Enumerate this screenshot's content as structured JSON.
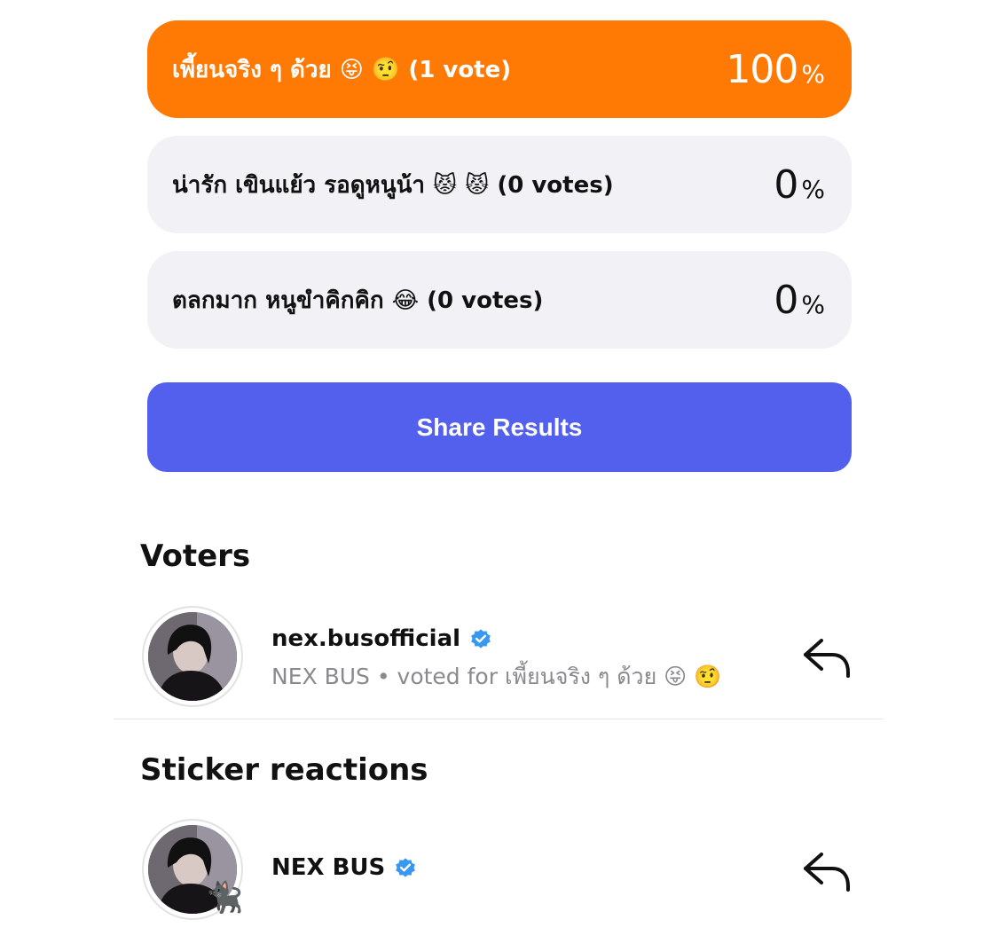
{
  "poll": {
    "options": [
      {
        "label": "เพี้ยนจริง ๆ ด้วย 😝 🤨 (1 vote)",
        "percent_number": "100",
        "percent_sign": "%",
        "selected": true,
        "fraction": 1.0
      },
      {
        "label": "น่ารัก เขินแย้ว รอดูหนูน้า 😾 😾 (0 votes)",
        "percent_number": "0",
        "percent_sign": "%",
        "selected": false,
        "fraction": 0.0
      },
      {
        "label": "ตลกมาก หนูขำคิกคิก 😂 (0 votes)",
        "percent_number": "0",
        "percent_sign": "%",
        "selected": false,
        "fraction": 0.0
      }
    ],
    "share_label": "Share Results"
  },
  "voters": {
    "title": "Voters",
    "items": [
      {
        "username": "nex.busofficial",
        "subtitle": "NEX BUS • voted for เพี้ยนจริง ๆ ด้วย 😝 🤨",
        "verified": true
      }
    ]
  },
  "stickers": {
    "title": "Sticker reactions",
    "items": [
      {
        "username": "NEX BUS",
        "verified": true,
        "sticker": "🐈‍⬛"
      }
    ]
  },
  "colors": {
    "selected_option": "#ff7a05",
    "unselected_option": "#f2f2f6",
    "share_button": "#5360ee",
    "verified_badge": "#3897f0"
  },
  "icons": {
    "verified": "verified-badge-icon",
    "reply": "reply-arrow-icon"
  }
}
